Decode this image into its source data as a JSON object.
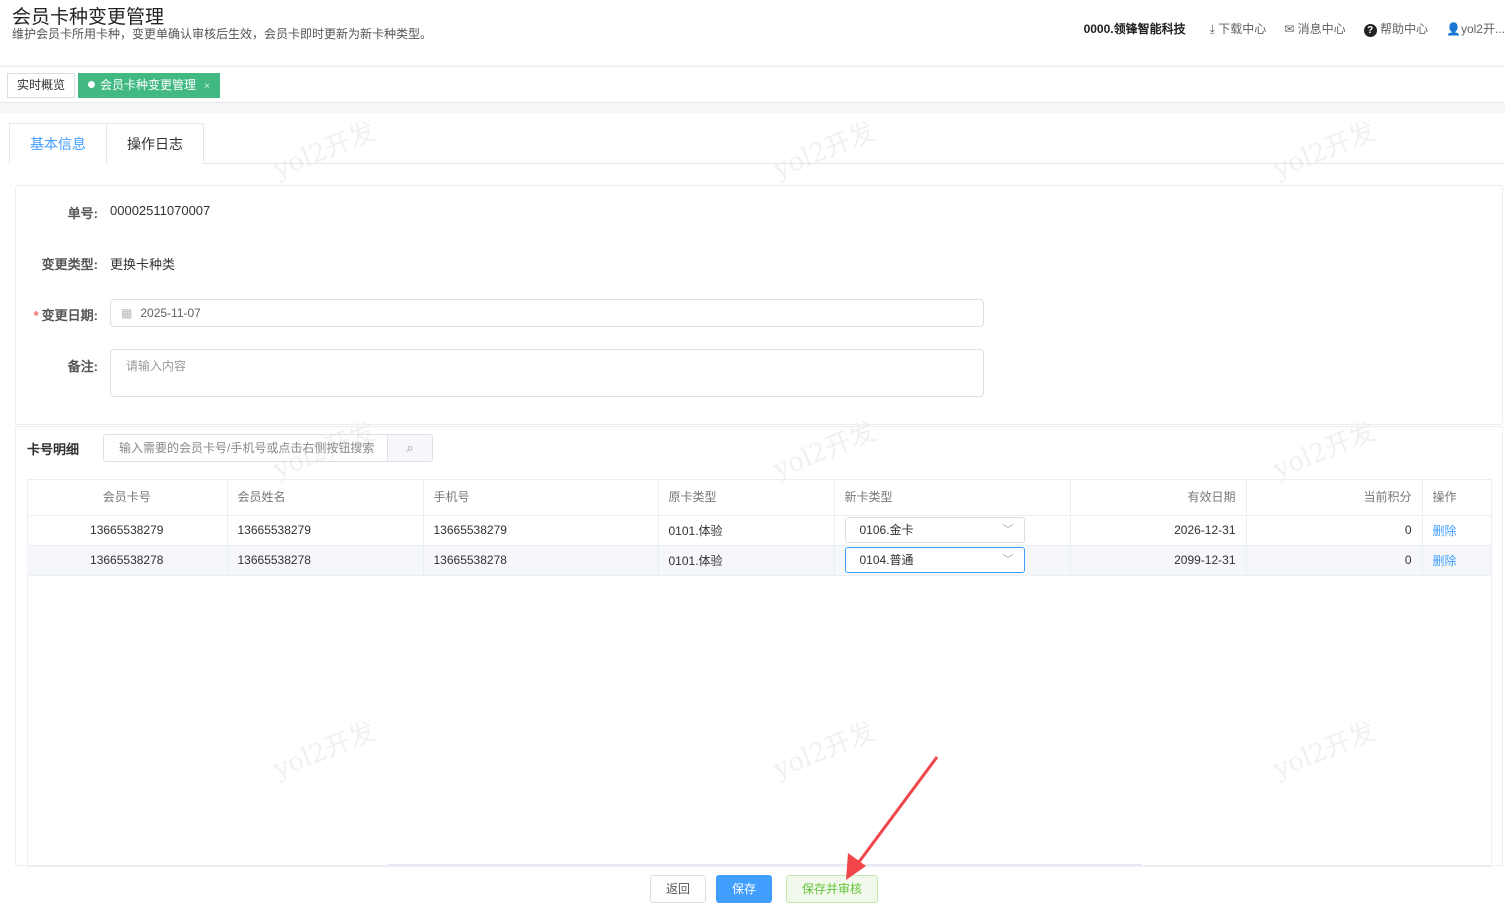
{
  "header": {
    "title": "会员卡种变更管理",
    "subtitle": "维护会员卡所用卡种，变更单确认审核后生效，会员卡即时更新为新卡种类型。",
    "org": "0000.领锋智能科技",
    "download": "下载中心",
    "messages": "消息中心",
    "help": "帮助中心",
    "user": "yol2开..."
  },
  "tags": [
    {
      "label": "实时概览"
    },
    {
      "label": "会员卡种变更管理",
      "close": "×"
    }
  ],
  "tabs": [
    {
      "label": "基本信息"
    },
    {
      "label": "操作日志"
    }
  ],
  "form": {
    "order_label": "单号:",
    "order_no": "00002511070007",
    "type_label": "变更类型:",
    "type_value": "更换卡种类",
    "date_label": "变更日期:",
    "date_value": "2025-11-07",
    "remark_label": "备注:",
    "remark_placeholder": "请输入内容"
  },
  "detail": {
    "title": "卡号明细",
    "search_placeholder": "输入需要的会员卡号/手机号或点击右侧按钮搜索",
    "columns": [
      "会员卡号",
      "会员姓名",
      "手机号",
      "原卡类型",
      "新卡类型",
      "有效日期",
      "当前积分",
      "操作"
    ],
    "rows": [
      {
        "card": "13665538279",
        "name": "13665538279",
        "phone": "13665538279",
        "old": "0101.体验",
        "new": "0106.金卡",
        "expiry": "2026-12-31",
        "points": "0",
        "action": "删除"
      },
      {
        "card": "13665538278",
        "name": "13665538278",
        "phone": "13665538278",
        "old": "0101.体验",
        "new": "0104.普通",
        "expiry": "2099-12-31",
        "points": "0",
        "action": "删除"
      }
    ]
  },
  "footer": {
    "back": "返回",
    "save": "保存",
    "save_audit": "保存并审核"
  },
  "watermark": "yol2开发",
  "colors": {
    "primary": "#409eff",
    "tag_active": "#42b983",
    "annotation_arrow": "#f0464a"
  }
}
